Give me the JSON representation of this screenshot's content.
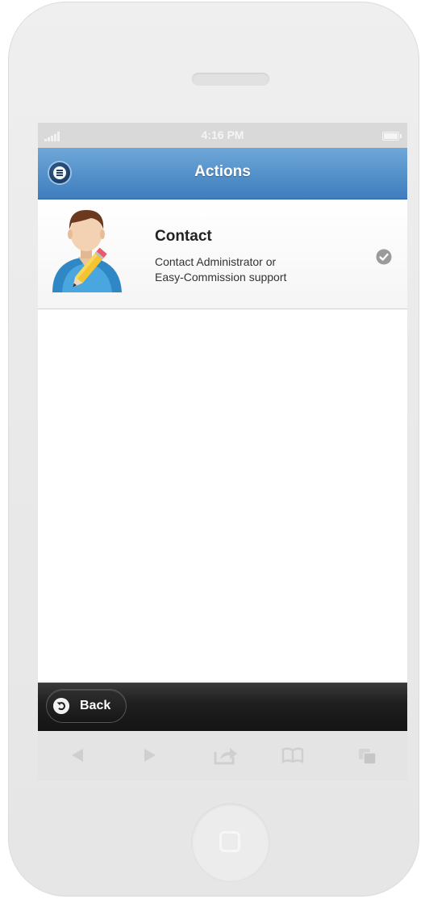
{
  "status_bar": {
    "time": "4:16 PM"
  },
  "header": {
    "title": "Actions"
  },
  "list": {
    "items": [
      {
        "title": "Contact",
        "description_line1": "Contact Administrator or",
        "description_line2": "Easy-Commission support"
      }
    ]
  },
  "footer": {
    "back_label": "Back"
  },
  "colors": {
    "header_blue": "#4f8cc6",
    "footer_black": "#1a1a1a",
    "device_gray": "#ebebeb"
  },
  "icons": {
    "menu": "menu-icon",
    "check": "check-icon",
    "back": "back-arrow-icon",
    "browser": [
      "browser-back-icon",
      "browser-forward-icon",
      "share-icon",
      "bookmarks-icon",
      "tabs-icon"
    ]
  }
}
